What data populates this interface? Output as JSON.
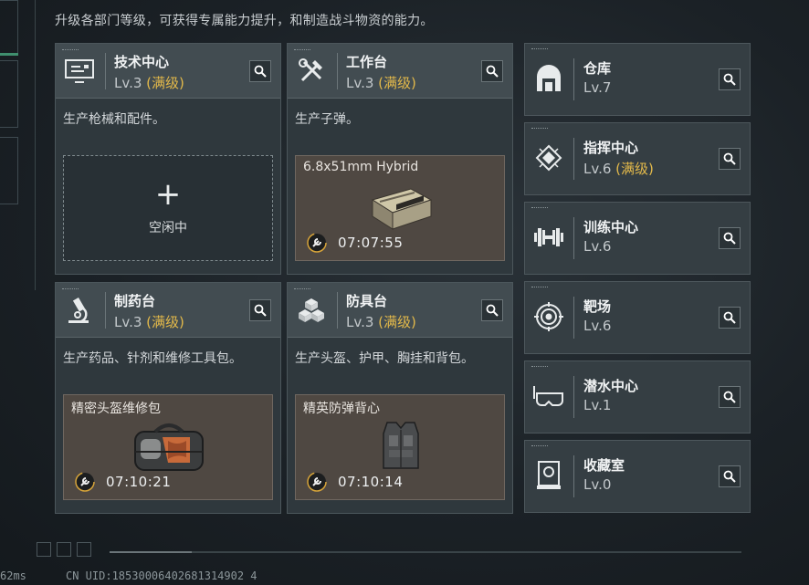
{
  "description": "升级各部门等级，可获得专属能力提升，和制造战斗物资的能力。",
  "cards": [
    {
      "name": "技术中心",
      "level": "Lv.3",
      "max": "(满级)",
      "desc": "生产枪械和配件。",
      "icon": "computer-icon",
      "state": "idle",
      "idle_plus": "+",
      "idle_text": "空闲中"
    },
    {
      "name": "工作台",
      "level": "Lv.3",
      "max": "(满级)",
      "desc": "生产子弹。",
      "icon": "tools-icon",
      "state": "producing",
      "product": "6.8x51mm Hybrid",
      "product_icon": "ammo-box-icon",
      "time": "07:07:55"
    },
    {
      "name": "制药台",
      "level": "Lv.3",
      "max": "(满级)",
      "desc": "生产药品、针剂和维修工具包。",
      "icon": "microscope-icon",
      "state": "producing",
      "product": "精密头盔维修包",
      "product_icon": "repair-bag-icon",
      "time": "07:10:21"
    },
    {
      "name": "防具台",
      "level": "Lv.3",
      "max": "(满级)",
      "desc": "生产头盔、护甲、胸挂和背包。",
      "icon": "cubes-icon",
      "state": "producing",
      "product": "精英防弹背心",
      "product_icon": "vest-icon",
      "time": "07:10:14"
    }
  ],
  "side": [
    {
      "name": "仓库",
      "level": "Lv.7",
      "max": "",
      "icon": "warehouse-icon"
    },
    {
      "name": "指挥中心",
      "level": "Lv.6",
      "max": "(满级)",
      "icon": "chip-icon"
    },
    {
      "name": "训练中心",
      "level": "Lv.6",
      "max": "",
      "icon": "dumbbell-icon"
    },
    {
      "name": "靶场",
      "level": "Lv.6",
      "max": "",
      "icon": "target-icon"
    },
    {
      "name": "潜水中心",
      "level": "Lv.1",
      "max": "",
      "icon": "diving-mask-icon"
    },
    {
      "name": "收藏室",
      "level": "Lv.0",
      "max": "",
      "icon": "collection-icon"
    }
  ],
  "footer": {
    "ping": "62ms",
    "uid": "CN UID:18530006402681314902 4"
  },
  "colors": {
    "accent_max": "#e3b94a",
    "card_bg": "#2f383d",
    "product_bg": "#4f4842"
  }
}
